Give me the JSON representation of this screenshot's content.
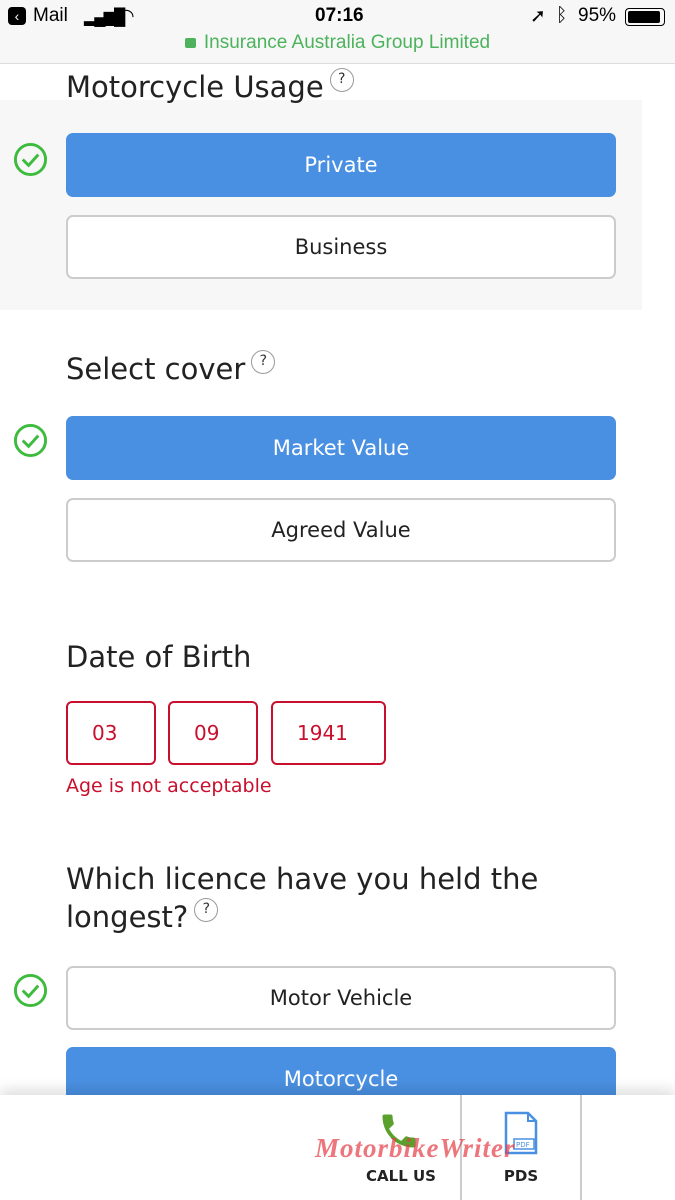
{
  "status_bar": {
    "back_app": "Mail",
    "time": "07:16",
    "battery": "95%",
    "site": "Insurance Australia Group Limited"
  },
  "usage": {
    "title": "Motorcycle Usage",
    "help": "?",
    "options": [
      "Private",
      "Business"
    ],
    "selected": "Private"
  },
  "cover": {
    "title": "Select cover",
    "help": "?",
    "options": [
      "Market Value",
      "Agreed Value"
    ],
    "selected": "Market Value"
  },
  "dob": {
    "title": "Date of Birth",
    "day": "03",
    "month": "09",
    "year": "1941",
    "error": "Age is not acceptable"
  },
  "licence": {
    "title_line1": "Which licence have you held the",
    "title_line2": "longest?",
    "help": "?",
    "options": [
      "Motor Vehicle",
      "Motorcycle"
    ]
  },
  "bottom_bar": {
    "call": "CALL US",
    "pds": "PDS",
    "pdf_badge": "PDF"
  },
  "watermark": "MotorbikeWriter",
  "colors": {
    "selected": "#4a90e2",
    "error": "#c8102e",
    "check": "#3dbb3d"
  }
}
